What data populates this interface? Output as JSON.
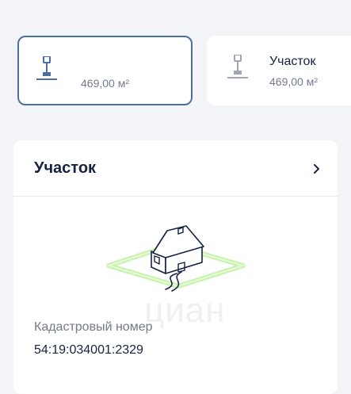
{
  "cards": [
    {
      "title": "",
      "area": "469,00 м²",
      "selected": true,
      "icon": "shovel-icon"
    },
    {
      "title": "Участок",
      "area": "469,00 м²",
      "selected": false,
      "icon": "shovel-icon"
    }
  ],
  "plot_section": {
    "title": "Участок",
    "chevron_icon": "chevron-right-icon",
    "illustration_icon": "house-on-plot-icon",
    "cadastral_label": "Кадастровый номер",
    "cadastral_value": "54:19:034001:2329",
    "watermark": "циан"
  },
  "colors": {
    "background": "#f2f4f8",
    "card": "#ffffff",
    "selected_border": "#4a6fa5",
    "text_primary": "#152242",
    "text_secondary": "#737a8e",
    "plot_green": "#b9ee9a"
  }
}
